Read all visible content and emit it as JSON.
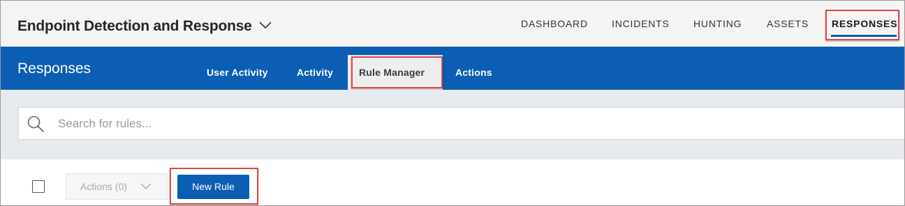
{
  "header": {
    "app_title": "Endpoint Detection and Response",
    "app_switcher_icon": "chevron-down-icon",
    "nav": [
      {
        "label": "DASHBOARD",
        "active": false
      },
      {
        "label": "INCIDENTS",
        "active": false
      },
      {
        "label": "HUNTING",
        "active": false
      },
      {
        "label": "ASSETS",
        "active": false
      },
      {
        "label": "RESPONSES",
        "active": true
      }
    ]
  },
  "section": {
    "title": "Responses",
    "tabs": [
      {
        "label": "User Activity",
        "active": false
      },
      {
        "label": "Activity",
        "active": false
      },
      {
        "label": "Rule Manager",
        "active": true
      },
      {
        "label": "Actions",
        "active": false
      }
    ]
  },
  "search": {
    "icon": "search-icon",
    "placeholder": "Search for rules...",
    "value": ""
  },
  "toolbar": {
    "select_all_checked": false,
    "actions_label": "Actions (0)",
    "actions_icon": "chevron-down-icon",
    "new_rule_label": "New Rule"
  },
  "colors": {
    "brand_blue": "#0c5db4",
    "highlight_red": "#e0484a",
    "header_bg": "#f4f4f4",
    "search_area_bg": "#e6e9ee"
  }
}
